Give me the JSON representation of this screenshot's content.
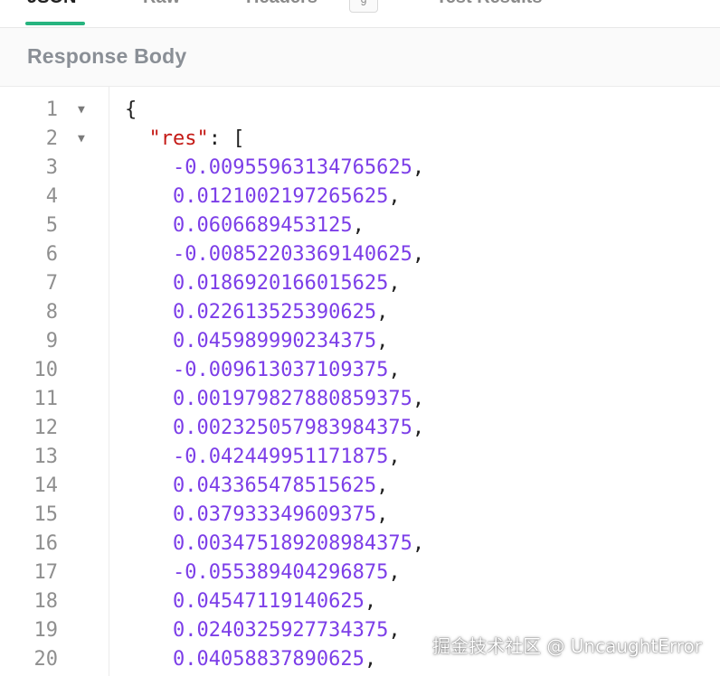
{
  "tabs": [
    {
      "label": "JSON",
      "active": true
    },
    {
      "label": "Raw",
      "active": false
    },
    {
      "label": "Headers",
      "active": false,
      "badge": "9"
    },
    {
      "label": "Test Results",
      "active": false
    }
  ],
  "section": {
    "title": "Response Body"
  },
  "editor": {
    "key": "res",
    "lines": [
      {
        "n": "1"
      },
      {
        "n": "2"
      },
      {
        "n": "3"
      },
      {
        "n": "4"
      },
      {
        "n": "5"
      },
      {
        "n": "6"
      },
      {
        "n": "7"
      },
      {
        "n": "8"
      },
      {
        "n": "9"
      },
      {
        "n": "10"
      },
      {
        "n": "11"
      },
      {
        "n": "12"
      },
      {
        "n": "13"
      },
      {
        "n": "14"
      },
      {
        "n": "15"
      },
      {
        "n": "16"
      },
      {
        "n": "17"
      },
      {
        "n": "18"
      },
      {
        "n": "19"
      },
      {
        "n": "20"
      }
    ],
    "open_brace": "{",
    "open_bracket": "[",
    "values": [
      "-0.00955963134765625",
      "0.0121002197265625",
      "0.0606689453125",
      "-0.00852203369140625",
      "0.018692016601562 5",
      "0.02261352539062 5",
      "0.045989990234375",
      "-0.009613037109375",
      "0.001979827880859375",
      "0.002325057983984375",
      "-0.042449951171875",
      "0.043365478515625",
      "0.037933349609375",
      "0.003475189208984375",
      "-0.055389404296875",
      "0.0454711914062 5",
      "0.024032592773437 5",
      "0.04058837890625"
    ]
  },
  "watermark": "掘金技术社区 @ UncaughtError",
  "colors": {
    "accent": "#27b47f",
    "key": "#c41a16",
    "number": "#7c3ee8"
  }
}
